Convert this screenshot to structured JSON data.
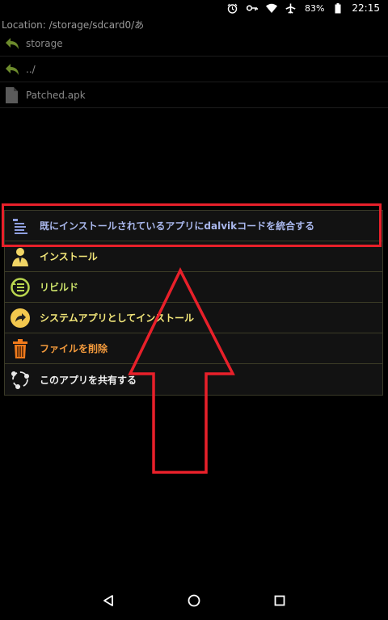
{
  "status_bar": {
    "icons": [
      "alarm-icon",
      "key-icon",
      "wifi-icon",
      "airplane-icon"
    ],
    "battery_percent": "83%",
    "time": "22:15"
  },
  "location": "Location: /storage/sdcard0/あ",
  "files": [
    {
      "name": "storage",
      "icon": "back-arrow-icon"
    },
    {
      "name": "../",
      "icon": "back-arrow-icon"
    },
    {
      "name": "Patched.apk",
      "icon": "file-icon"
    }
  ],
  "menu": {
    "items": [
      {
        "label": "既にインストールされているアプリにdalvikコードを統合する",
        "icon": "merge-list-icon",
        "color": "#a9b7ec"
      },
      {
        "label": "インストール",
        "icon": "install-person-icon",
        "color": "#f3e77a"
      },
      {
        "label": "リビルド",
        "icon": "rebuild-list-icon",
        "color": "#cde36b"
      },
      {
        "label": "システムアプリとしてインストール",
        "icon": "curved-arrow-icon",
        "color": "#f3e77a"
      },
      {
        "label": "ファイルを削除",
        "icon": "trash-icon",
        "color": "#f39a3c"
      },
      {
        "label": "このアプリを共有する",
        "icon": "share-circle-icon",
        "color": "#f0f0f0"
      }
    ]
  },
  "annotation": {
    "highlight_color": "#e8202a"
  },
  "nav_bar": {
    "icons": [
      "back-triangle-icon",
      "home-circle-icon",
      "recents-square-icon"
    ]
  }
}
